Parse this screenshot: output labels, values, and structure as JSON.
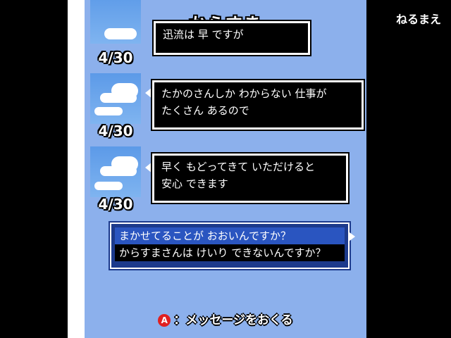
{
  "header": {
    "title": "からすま",
    "status": "ねるまえ"
  },
  "messages": [
    {
      "date": "4/30",
      "lines": "迅流は 早 ですが"
    },
    {
      "date": "4/30",
      "lines": "たかのさんしか わからない 仕事が\nたくさん あるので"
    },
    {
      "date": "4/30",
      "lines": "早く もどってきて いただけると\n安心 できます"
    }
  ],
  "choices": [
    "まかせてることが おおいんですか？",
    "からすまさんは けいり できないんですか？"
  ],
  "prompt": {
    "button": "A",
    "label": "：メッセージをおくる"
  }
}
